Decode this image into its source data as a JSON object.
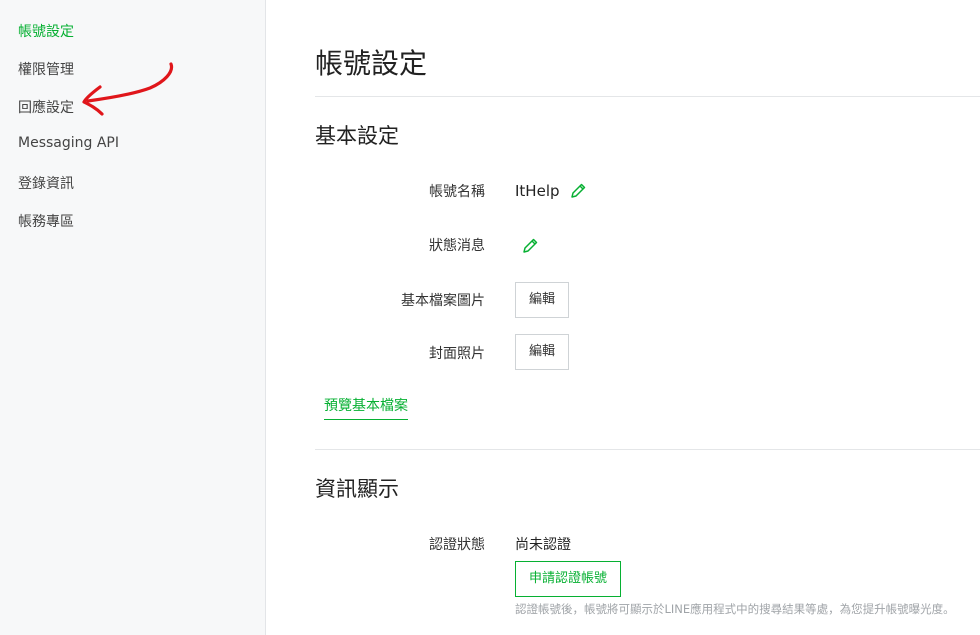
{
  "sidebar": {
    "items": [
      {
        "label": "帳號設定",
        "active": true
      },
      {
        "label": "權限管理",
        "active": false
      },
      {
        "label": "回應設定",
        "active": false
      },
      {
        "label": "Messaging API",
        "active": false
      },
      {
        "label": "登錄資訊",
        "active": false
      },
      {
        "label": "帳務專區",
        "active": false
      }
    ]
  },
  "main": {
    "title": "帳號設定",
    "basic": {
      "title": "基本設定",
      "account_name_label": "帳號名稱",
      "account_name_value": "ItHelp",
      "status_message_label": "狀態消息",
      "profile_image_label": "基本檔案圖片",
      "profile_image_button": "編輯",
      "cover_photo_label": "封面照片",
      "cover_photo_button": "編輯",
      "preview_link": "預覽基本檔案"
    },
    "info": {
      "title": "資訊顯示",
      "verification_label": "認證狀態",
      "verification_value": "尚未認證",
      "apply_button": "申請認證帳號",
      "helper_text": "認證帳號後，帳號將可顯示於LINE應用程式中的搜尋結果等處，為您提升帳號曝光度。"
    }
  },
  "colors": {
    "accent": "#06b032",
    "annotation": "#e0161b",
    "sidebar_bg": "#f7f8f9"
  },
  "icons": {
    "edit": "pencil-icon",
    "annotation": "red-arrow-annotation"
  }
}
